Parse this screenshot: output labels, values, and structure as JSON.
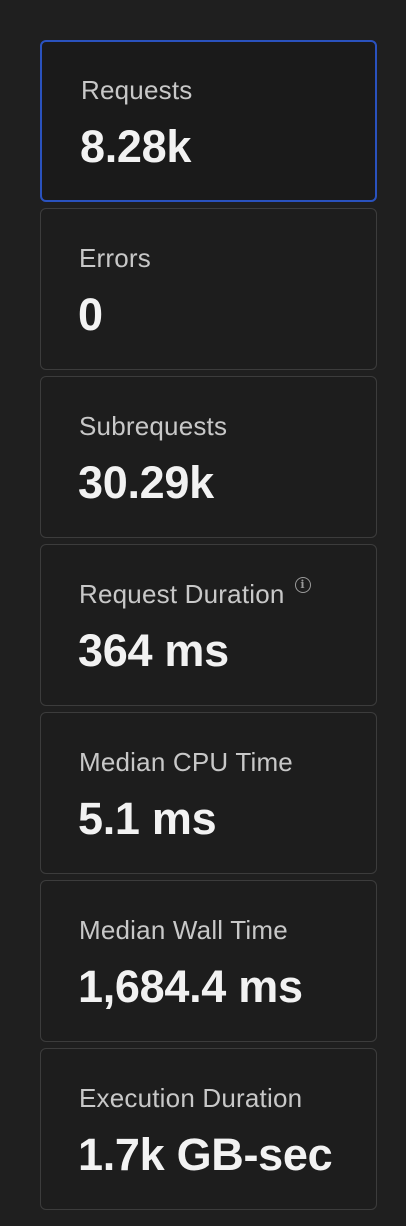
{
  "metrics": [
    {
      "label": "Requests",
      "value": "8.28k",
      "selected": true
    },
    {
      "label": "Errors",
      "value": "0"
    },
    {
      "label": "Subrequests",
      "value": "30.29k"
    },
    {
      "label": "Request Duration",
      "value": "364 ms",
      "info_icon": "info-icon"
    },
    {
      "label": "Median CPU Time",
      "value": "5.1 ms"
    },
    {
      "label": "Median Wall Time",
      "value": "1,684.4 ms"
    },
    {
      "label": "Execution Duration",
      "value": "1.7k GB-sec"
    }
  ],
  "colors": {
    "background": "#1f1f1f",
    "card_border": "#3c3c3c",
    "selected_border": "#2a52be",
    "label": "#c8c8c8",
    "value": "#f2f2f2"
  }
}
